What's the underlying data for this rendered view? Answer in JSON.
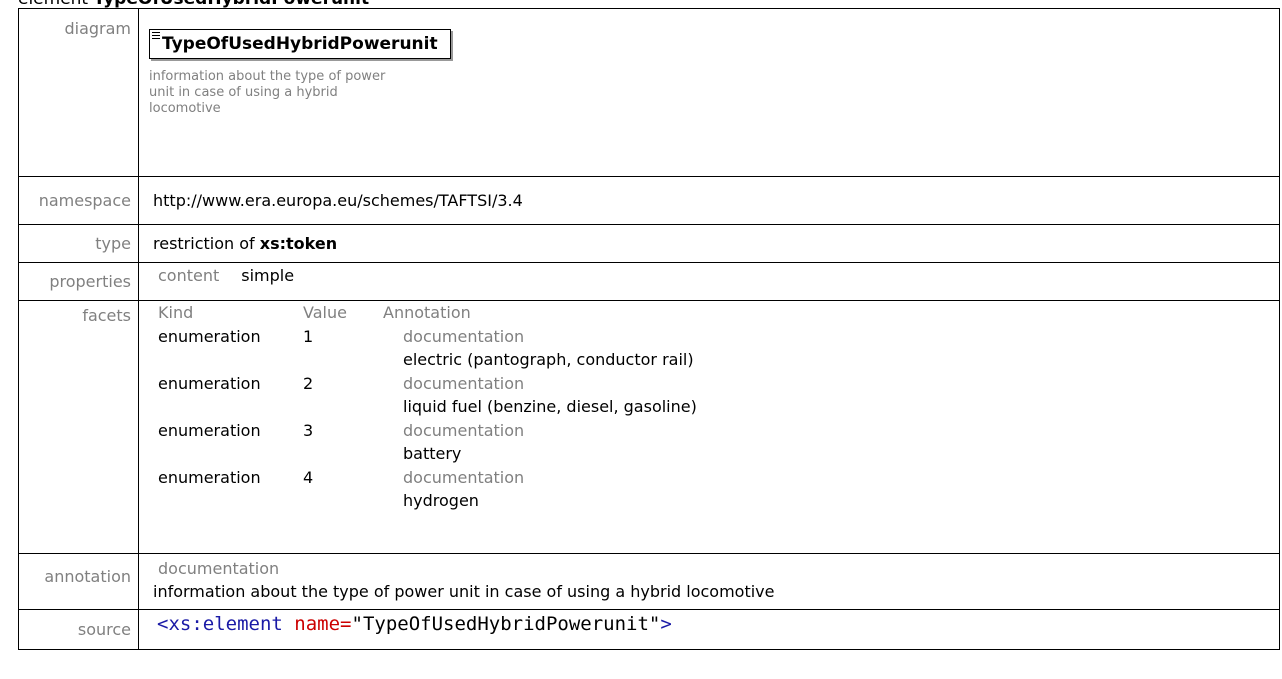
{
  "heading": {
    "prefix": "element",
    "name": "TypeOfUsedHybridPowerunit"
  },
  "rows": {
    "diagram": {
      "label": "diagram",
      "element_name": "TypeOfUsedHybridPowerunit",
      "doc": "information about the type of power unit in case of using a hybrid locomotive"
    },
    "namespace": {
      "label": "namespace",
      "value": "http://www.era.europa.eu/schemes/TAFTSI/3.4"
    },
    "type": {
      "label": "type",
      "prefix": "restriction of",
      "base": "xs:token"
    },
    "properties": {
      "label": "properties",
      "key": "content",
      "value": "simple"
    },
    "facets": {
      "label": "facets",
      "headers": [
        "Kind",
        "Value",
        "Annotation"
      ],
      "items": [
        {
          "kind": "enumeration",
          "value": "1",
          "anno_label": "documentation",
          "anno_text": "electric (pantograph, conductor rail)"
        },
        {
          "kind": "enumeration",
          "value": "2",
          "anno_label": "documentation",
          "anno_text": "liquid fuel (benzine, diesel, gasoline)"
        },
        {
          "kind": "enumeration",
          "value": "3",
          "anno_label": "documentation",
          "anno_text": "battery"
        },
        {
          "kind": "enumeration",
          "value": "4",
          "anno_label": "documentation",
          "anno_text": "hydrogen"
        }
      ]
    },
    "annotation": {
      "label": "annotation",
      "doc_label": "documentation",
      "doc_text": "information about the type of power unit in case of using a hybrid locomotive"
    },
    "source": {
      "label": "source",
      "tag_open": "<xs:element",
      "attr": "name=",
      "attr_value": "\"TypeOfUsedHybridPowerunit\"",
      "tag_close": ">"
    }
  }
}
